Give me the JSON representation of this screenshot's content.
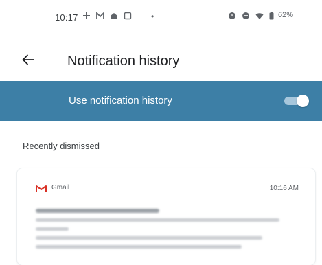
{
  "status_bar": {
    "time": "10:17",
    "left_icons": [
      "game-icon",
      "mail-icon",
      "home-icon",
      "screenshot-icon"
    ],
    "separator": "•",
    "right_icons": [
      "alarm-icon",
      "dnd-icon",
      "wifi-icon",
      "battery-icon"
    ],
    "battery": "62%"
  },
  "app_bar": {
    "title": "Notification history"
  },
  "banner": {
    "label": "Use notification history",
    "toggle_on": true,
    "color": "#3d7fa6"
  },
  "section": {
    "header": "Recently dismissed"
  },
  "notifications": [
    {
      "app": "Gmail",
      "time": "10:16 AM",
      "icon": "gmail-icon"
    }
  ]
}
